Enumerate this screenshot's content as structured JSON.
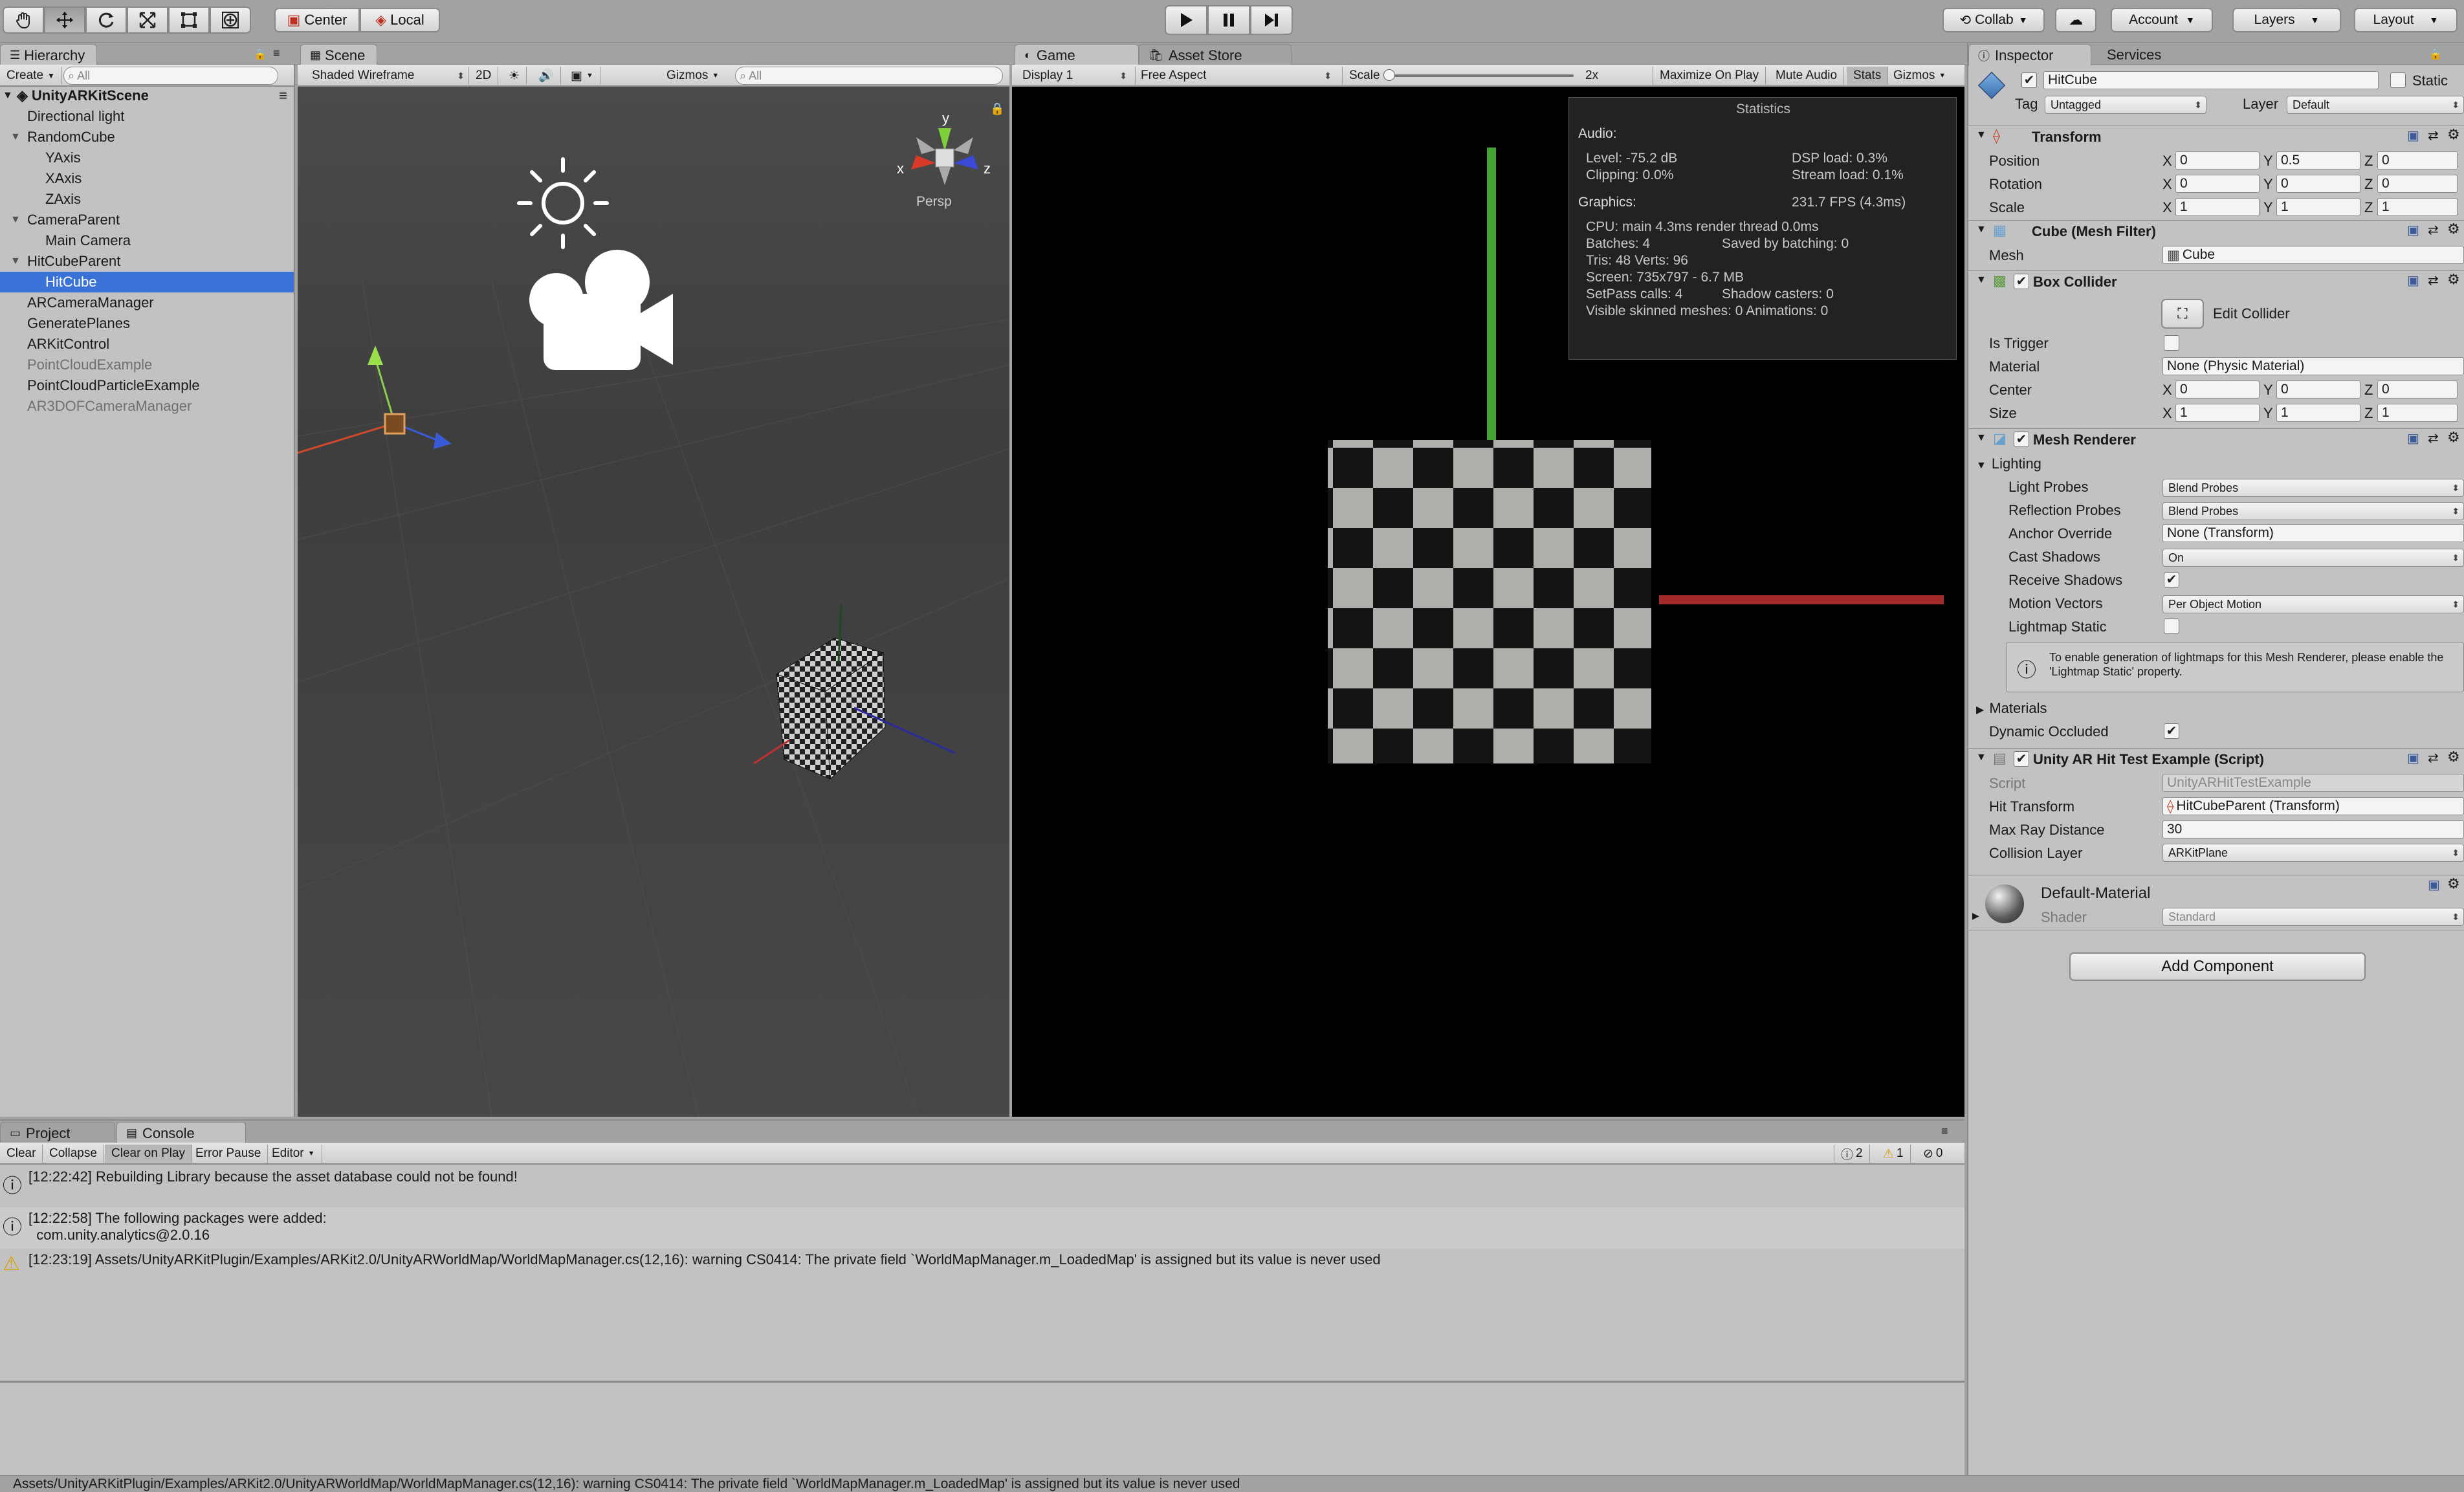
{
  "toolbar": {
    "pivot_center": "Center",
    "pivot_local": "Local",
    "collab": "Collab",
    "account": "Account",
    "layers": "Layers",
    "layout": "Layout"
  },
  "hierarchy": {
    "tab": "Hierarchy",
    "create": "Create",
    "search_placeholder": "All",
    "scene": "UnityARKitScene",
    "items": [
      {
        "label": "Directional light",
        "indent": 1
      },
      {
        "label": "RandomCube",
        "indent": 1,
        "expander": true
      },
      {
        "label": "YAxis",
        "indent": 2
      },
      {
        "label": "XAxis",
        "indent": 2
      },
      {
        "label": "ZAxis",
        "indent": 2
      },
      {
        "label": "CameraParent",
        "indent": 1,
        "expander": true
      },
      {
        "label": "Main Camera",
        "indent": 2
      },
      {
        "label": "HitCubeParent",
        "indent": 1,
        "expander": true
      },
      {
        "label": "HitCube",
        "indent": 2,
        "selected": true
      },
      {
        "label": "ARCameraManager",
        "indent": 1
      },
      {
        "label": "GeneratePlanes",
        "indent": 1
      },
      {
        "label": "ARKitControl",
        "indent": 1
      },
      {
        "label": "PointCloudExample",
        "indent": 1,
        "dim": true
      },
      {
        "label": "PointCloudParticleExample",
        "indent": 1
      },
      {
        "label": "AR3DOFCameraManager",
        "indent": 1,
        "dim": true
      }
    ]
  },
  "scene": {
    "tab": "Scene",
    "shading": "Shaded Wireframe",
    "mode_2d": "2D",
    "gizmos": "Gizmos",
    "search_placeholder": "All",
    "persp": "Persp",
    "axis_x": "x",
    "axis_y": "y",
    "axis_z": "z"
  },
  "game": {
    "tab": "Game",
    "store_tab": "Asset Store",
    "display": "Display 1",
    "aspect": "Free Aspect",
    "scale_label": "Scale",
    "scale_value": "2x",
    "maximize": "Maximize On Play",
    "mute": "Mute Audio",
    "stats": "Stats",
    "gizmos": "Gizmos",
    "statistics": {
      "title": "Statistics",
      "audio_header": "Audio:",
      "level": "Level: -75.2 dB",
      "dsp": "DSP load: 0.3%",
      "clipping": "Clipping: 0.0%",
      "stream": "Stream load: 0.1%",
      "graphics_header": "Graphics:",
      "fps": "231.7 FPS (4.3ms)",
      "cpu": "CPU: main 4.3ms  render thread 0.0ms",
      "batches": "Batches: 4",
      "saved": "Saved by batching: 0",
      "tris": "Tris: 48  Verts: 96",
      "screen": "Screen: 735x797 - 6.7 MB",
      "setpass": "SetPass calls: 4",
      "shadow": "Shadow casters: 0",
      "skinned": "Visible skinned meshes: 0  Animations: 0"
    }
  },
  "inspector": {
    "tab": "Inspector",
    "services_tab": "Services",
    "object_name": "HitCube",
    "static_label": "Static",
    "tag_label": "Tag",
    "tag_value": "Untagged",
    "layer_label": "Layer",
    "layer_value": "Default",
    "transform": {
      "title": "Transform",
      "position_label": "Position",
      "rotation_label": "Rotation",
      "scale_label": "Scale",
      "x": "X",
      "y": "Y",
      "z": "Z",
      "position": [
        "0",
        "0.5",
        "0"
      ],
      "rotation": [
        "0",
        "0",
        "0"
      ],
      "scale": [
        "1",
        "1",
        "1"
      ]
    },
    "mesh_filter": {
      "title": "Cube (Mesh Filter)",
      "mesh_label": "Mesh",
      "mesh_value": "Cube"
    },
    "box_collider": {
      "title": "Box Collider",
      "edit_label": "Edit Collider",
      "trigger_label": "Is Trigger",
      "material_label": "Material",
      "material_value": "None (Physic Material)",
      "center_label": "Center",
      "size_label": "Size",
      "center": [
        "0",
        "0",
        "0"
      ],
      "size": [
        "1",
        "1",
        "1"
      ]
    },
    "mesh_renderer": {
      "title": "Mesh Renderer",
      "lighting": "Lighting",
      "light_probes_label": "Light Probes",
      "light_probes": "Blend Probes",
      "reflection_label": "Reflection Probes",
      "reflection": "Blend Probes",
      "anchor_label": "Anchor Override",
      "anchor": "None (Transform)",
      "cast_label": "Cast Shadows",
      "cast": "On",
      "receive_label": "Receive Shadows",
      "motion_label": "Motion Vectors",
      "motion": "Per Object Motion",
      "lightmap_label": "Lightmap Static",
      "info": "To enable generation of lightmaps for this Mesh Renderer, please enable the 'Lightmap Static' property.",
      "materials": "Materials",
      "dynamic_label": "Dynamic Occluded"
    },
    "script": {
      "title": "Unity AR Hit Test Example (Script)",
      "script_label": "Script",
      "script_value": "UnityARHitTestExample",
      "hit_label": "Hit Transform",
      "hit_value": "HitCubeParent (Transform)",
      "ray_label": "Max Ray Distance",
      "ray_value": "30",
      "collision_label": "Collision Layer",
      "collision_value": "ARKitPlane"
    },
    "material": {
      "name": "Default-Material",
      "shader_label": "Shader",
      "shader_value": "Standard"
    },
    "add_component": "Add Component"
  },
  "console": {
    "project_tab": "Project",
    "console_tab": "Console",
    "clear": "Clear",
    "collapse": "Collapse",
    "clear_on_play": "Clear on Play",
    "error_pause": "Error Pause",
    "editor": "Editor",
    "info_count": "2",
    "warn_count": "1",
    "error_count": "0",
    "entries": [
      {
        "type": "info",
        "lines": [
          "[12:22:42] Rebuilding Library because the asset database could not be found!"
        ]
      },
      {
        "type": "info",
        "lines": [
          "[12:22:58] The following packages were added:",
          "  com.unity.analytics@2.0.16"
        ]
      },
      {
        "type": "warning",
        "lines": [
          "[12:23:19] Assets/UnityARKitPlugin/Examples/ARKit2.0/UnityARWorldMap/WorldMapManager.cs(12,16): warning CS0414: The private field `WorldMapManager.m_LoadedMap' is assigned but its value is never used"
        ]
      }
    ]
  },
  "statusbar": {
    "text": "Assets/UnityARKitPlugin/Examples/ARKit2.0/UnityARWorldMap/WorldMapManager.cs(12,16): warning CS0414: The private field `WorldMapManager.m_LoadedMap' is assigned but its value is never used"
  }
}
